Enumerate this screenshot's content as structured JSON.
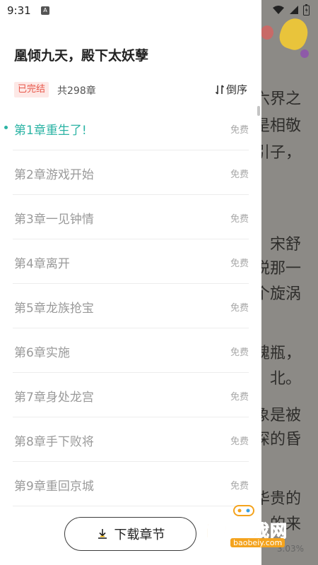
{
  "status_bar": {
    "time": "9:31",
    "notification_icon": "A"
  },
  "reader": {
    "visible_text": [
      "六界之",
      "是相敬",
      "引子，",
      "宋舒",
      "悦那一",
      "个旋涡",
      "魄瓶，",
      "北。",
      "象是被",
      "深的昏",
      "华贵的",
      "的来"
    ],
    "progress": "3.03%"
  },
  "book": {
    "title": "凰倾九天，殿下太妖孽",
    "status": "已完结",
    "chapter_count": "共298章",
    "sort_label": "倒序"
  },
  "chapters": [
    {
      "title": "第1章重生了!",
      "tag": "免费",
      "active": true
    },
    {
      "title": "第2章游戏开始",
      "tag": "免费"
    },
    {
      "title": "第3章一见钟情",
      "tag": "免费"
    },
    {
      "title": "第4章离开",
      "tag": "免费"
    },
    {
      "title": "第5章龙族抢宝",
      "tag": "免费"
    },
    {
      "title": "第6章实施",
      "tag": "免费"
    },
    {
      "title": "第7章身处龙宫",
      "tag": "免费"
    },
    {
      "title": "第8章手下败将",
      "tag": "免费"
    },
    {
      "title": "第9章重回京城",
      "tag": "免费"
    }
  ],
  "download": {
    "label": "下载章节"
  },
  "watermark": {
    "text": "宝贝游戏网",
    "url": "baobeiy.com"
  },
  "colors": {
    "accent": "#2bb3a4",
    "badge_text": "#e8574a",
    "badge_bg": "#fde8e6",
    "overlay": "#8c8a86"
  }
}
